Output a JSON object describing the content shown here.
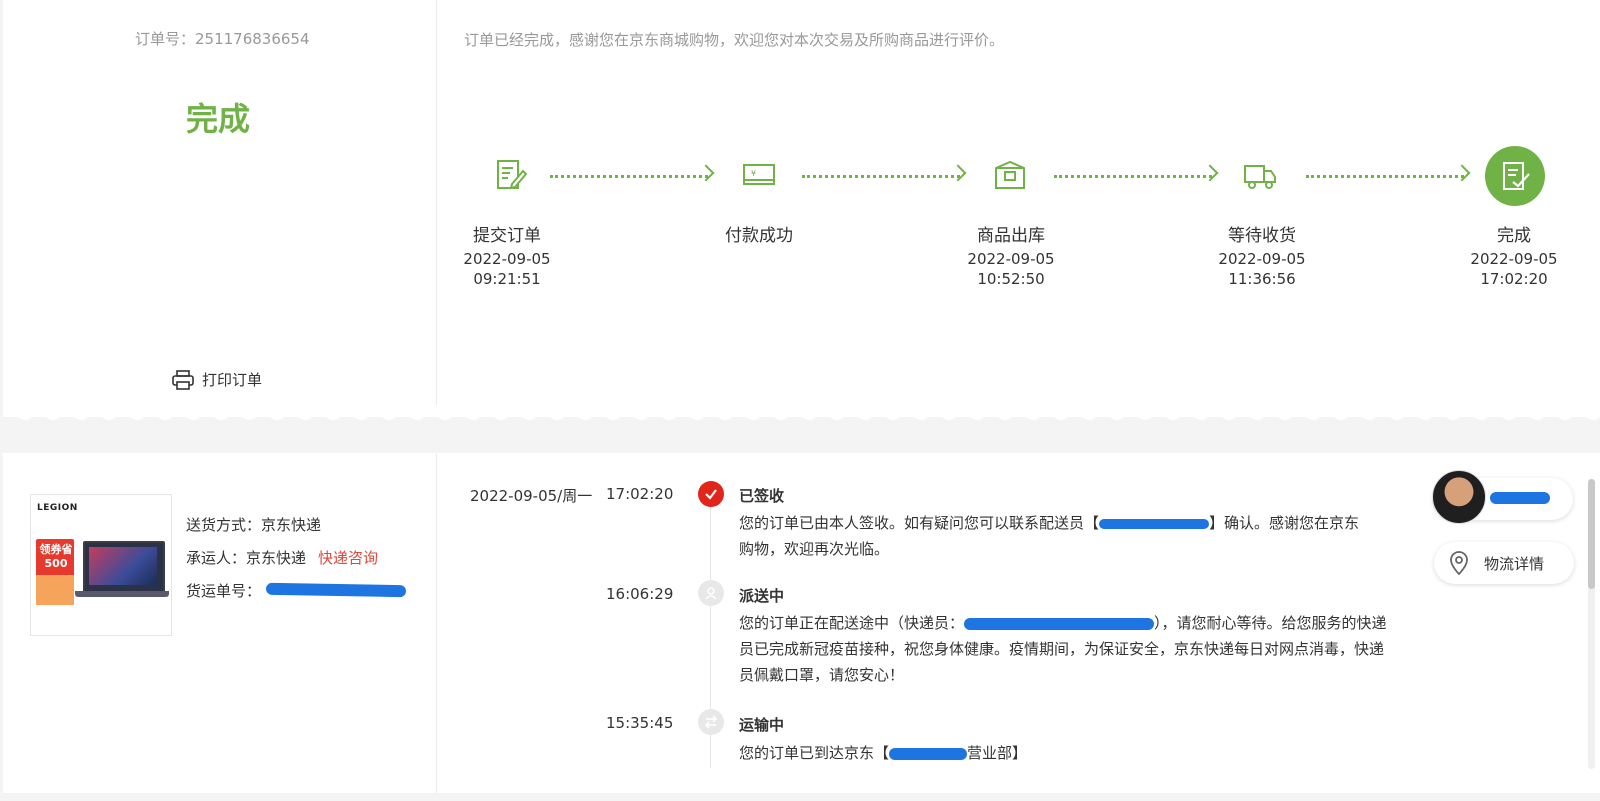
{
  "order": {
    "number_label": "订单号：251176836654",
    "status": "完成",
    "print_label": "打印订单",
    "notice": "订单已经完成，感谢您在京东商城购物，欢迎您对本次交易及所购商品进行评价。"
  },
  "steps": [
    {
      "label": "提交订单",
      "date": "2022-09-05",
      "time": "09:21:51",
      "icon": "edit-doc-icon"
    },
    {
      "label": "付款成功",
      "date": "",
      "time": "",
      "icon": "payment-card-icon"
    },
    {
      "label": "商品出库",
      "date": "2022-09-05",
      "time": "10:52:50",
      "icon": "package-icon"
    },
    {
      "label": "等待收货",
      "date": "2022-09-05",
      "time": "11:36:56",
      "icon": "truck-icon"
    },
    {
      "label": "完成",
      "date": "2022-09-05",
      "time": "17:02:20",
      "icon": "complete-icon"
    }
  ],
  "product": {
    "brand": "LEGION",
    "coupon": "领券省500"
  },
  "shipping": {
    "method_label": "送货方式：京东快递",
    "carrier_label": "承运人：京东快递",
    "consult_link": "快递咨询",
    "tracking_label": "货运单号："
  },
  "logistics": {
    "date": "2022-09-05/周一",
    "entries": [
      {
        "time": "17:02:20",
        "title": "已签收",
        "body_1": "您的订单已由本人签收。如有疑问您可以联系配送员【",
        "body_2": "】确认。感谢您在京东",
        "body_3": "购物，欢迎再次光临。"
      },
      {
        "time": "16:06:29",
        "title": "派送中",
        "body_1": "您的订单正在配送途中（快递员：",
        "body_2": "），请您耐心等待。给您服务的快递",
        "body_3": "员已完成新冠疫苗接种，祝您身体健康。疫情期间，为保证安全，京东快递每日对网点消毒，快递",
        "body_4": "员佩戴口罩，请您安心！"
      },
      {
        "time": "15:35:45",
        "title": "运输中",
        "body_1": "您的订单已到达京东【",
        "body_2": "营业部】"
      }
    ],
    "track_button": "物流详情"
  },
  "colors": {
    "accent_green": "#71b247",
    "accent_red": "#e1251b",
    "link_red": "#e0483c",
    "muted": "#999999"
  }
}
